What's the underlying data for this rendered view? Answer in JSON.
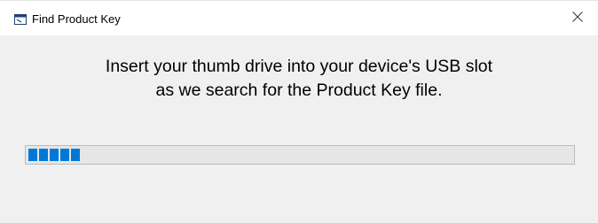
{
  "window": {
    "title": "Find Product Key",
    "icons": {
      "app": "app-window-icon",
      "close": "close-icon"
    }
  },
  "message": {
    "line1": "Insert your thumb drive into your device's USB slot",
    "line2": "as we search for the Product Key file."
  },
  "progress": {
    "value_percent": 10,
    "style": "blocks",
    "color": "#0078d7"
  }
}
